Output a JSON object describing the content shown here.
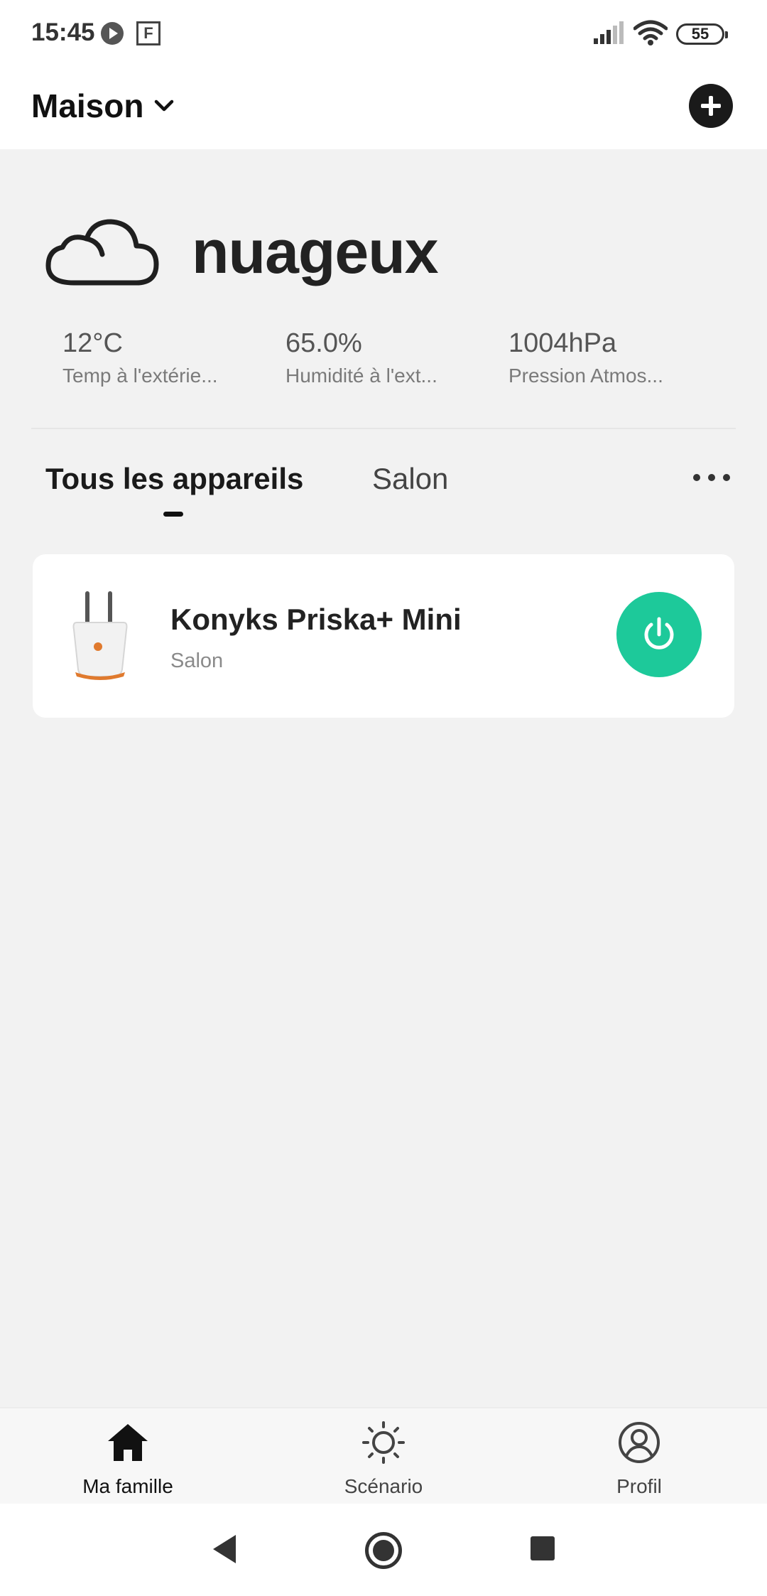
{
  "status_bar": {
    "time": "15:45",
    "f_badge": "F",
    "battery": "55",
    "icons": [
      "play-icon",
      "signal-icon",
      "wifi-icon",
      "battery-icon"
    ]
  },
  "header": {
    "home_name": "Maison",
    "dropdown_icon": "chevron-down-icon",
    "add_icon": "plus-icon"
  },
  "weather": {
    "icon": "cloud-icon",
    "condition": "nuageux",
    "stats": [
      {
        "value": "12°C",
        "label": "Temp à l'extérie..."
      },
      {
        "value": "65.0%",
        "label": "Humidité à l'ext..."
      },
      {
        "value": "1004hPa",
        "label": "Pression Atmos..."
      }
    ]
  },
  "tabs": [
    {
      "label": "Tous les appareils",
      "active": true
    },
    {
      "label": "Salon",
      "active": false
    }
  ],
  "devices": [
    {
      "name": "Konyks Priska+ Mini",
      "room": "Salon",
      "power": "on",
      "power_color": "#1dc99a"
    }
  ],
  "bottom_nav": [
    {
      "label": "Ma famille",
      "icon": "home-icon",
      "active": true
    },
    {
      "label": "Scénario",
      "icon": "sun-icon",
      "active": false
    },
    {
      "label": "Profil",
      "icon": "profile-icon",
      "active": false
    }
  ],
  "system_nav": [
    "back-icon",
    "home-circle-icon",
    "recents-icon"
  ]
}
